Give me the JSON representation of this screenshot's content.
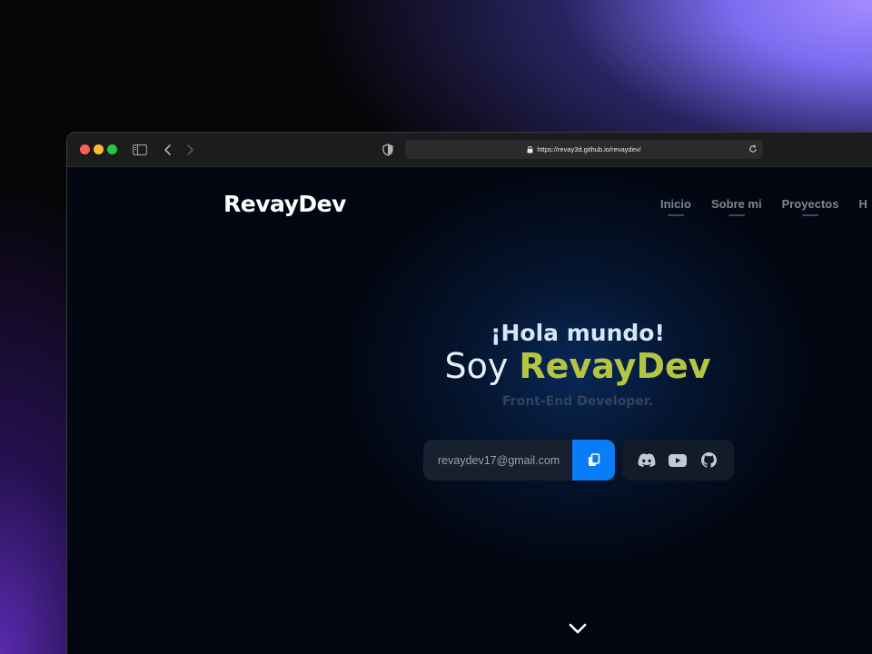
{
  "browser": {
    "url": "https://revay3d.github.io/revaydev/"
  },
  "site": {
    "logo": "RevayDev",
    "nav": [
      {
        "label": "Inicio"
      },
      {
        "label": "Sobre mi"
      },
      {
        "label": "Proyectos"
      },
      {
        "label": "H"
      }
    ]
  },
  "hero": {
    "greeting": "¡Hola mundo!",
    "intro_prefix": "Soy",
    "intro_name": "RevayDev",
    "role": "Front-End Developer."
  },
  "contact": {
    "email": "revaydev17@gmail.com",
    "copy_icon": "copy-icon",
    "social": [
      {
        "icon": "discord-icon"
      },
      {
        "icon": "youtube-icon"
      },
      {
        "icon": "github-icon"
      }
    ]
  },
  "scroll_icon": "chevron-down-icon",
  "colors": {
    "accent_name": "#b4c542",
    "copy_button": "#0a7cf7",
    "page_bg": "#020611"
  }
}
